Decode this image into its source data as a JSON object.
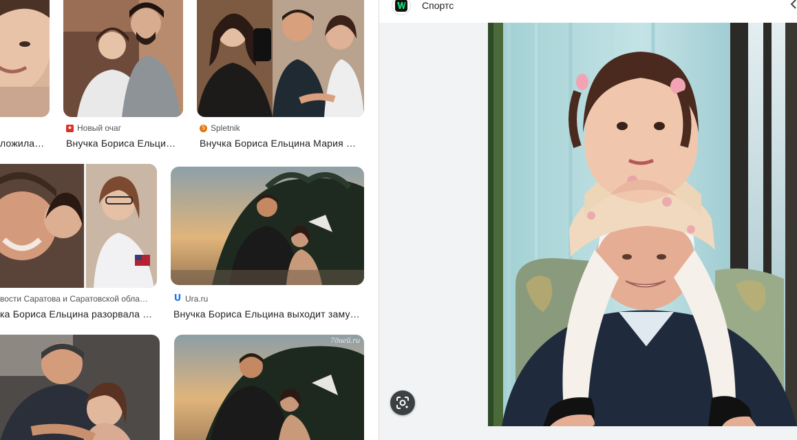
{
  "results": [
    {
      "source": "",
      "title": "ложила…",
      "favicon": "",
      "favicon_color": ""
    },
    {
      "source": "Новый очаг",
      "title": "Внучка Бориса Ельци…",
      "favicon": "star-icon",
      "favicon_color": "#d93025"
    },
    {
      "source": "Spletnik",
      "title": "Внучка Бориса Ельцина Мария …",
      "favicon": "s-icon",
      "favicon_color": "#e8710a"
    },
    {
      "source": "",
      "title": "",
      "favicon": "",
      "favicon_color": ""
    },
    {
      "source": "вости Саратова и Саратовской обла…",
      "title": "ка Бориса Ельцина разорвала …",
      "favicon": "",
      "favicon_color": ""
    },
    {
      "source": "Ura.ru",
      "title": "Внучка Бориса Ельцина выходит заму…",
      "favicon": "u-icon",
      "favicon_color": "#1a73e8"
    },
    {
      "source": "",
      "title": "",
      "favicon": "",
      "favicon_color": ""
    },
    {
      "source": "",
      "title": "",
      "favicon": "",
      "favicon_color": ""
    }
  ],
  "watermark": "7дней.ru",
  "panel": {
    "site_name": "Спортс",
    "logo_icon": "sports-ru-logo-icon",
    "accent": "#16e07e",
    "close_icon": "chevron-left-icon",
    "lens_icon": "google-lens-icon"
  }
}
